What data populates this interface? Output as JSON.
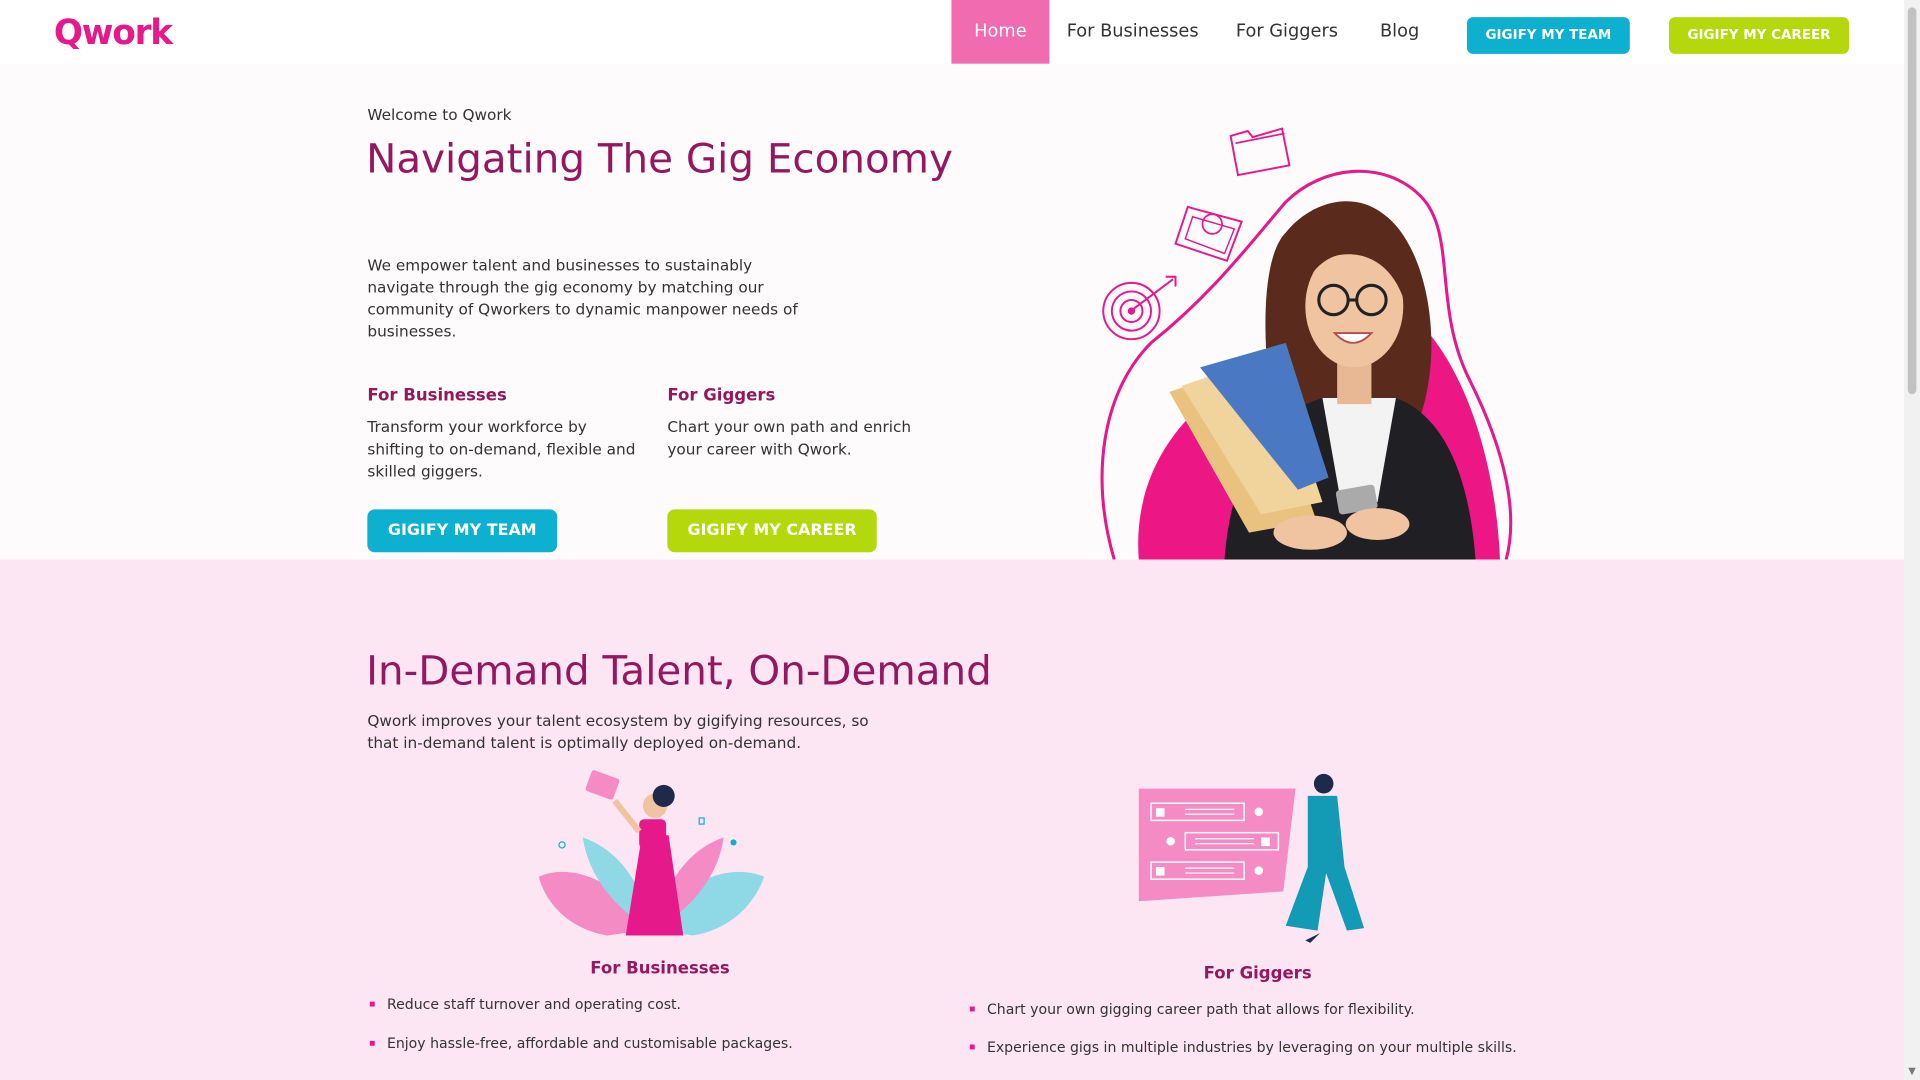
{
  "header": {
    "logo": "Qwork",
    "nav": [
      "Home",
      "For Businesses",
      "For Giggers",
      "Blog"
    ],
    "btn_team": "GIGIFY MY TEAM",
    "btn_career": "GIGIFY MY CAREER"
  },
  "hero": {
    "welcome": "Welcome to Qwork",
    "title": "Navigating The Gig Economy",
    "description": "We empower talent and businesses to sustainably navigate through the gig economy by matching our community of Qworkers to dynamic manpower needs of businesses.",
    "businesses": {
      "heading": "For Businesses",
      "text": "Transform your workforce by shifting to on-demand, flexible and skilled giggers.",
      "button": "GIGIFY MY TEAM"
    },
    "giggers": {
      "heading": "For Giggers",
      "text": "Chart your own path and enrich your career with Qwork.",
      "button": "GIGIFY MY CAREER"
    }
  },
  "talent": {
    "title": "In-Demand Talent, On-Demand",
    "description": "Qwork improves your talent ecosystem by gigifying resources, so that in-demand talent is optimally deployed on-demand.",
    "businesses": {
      "heading": "For Businesses",
      "bullets": [
        "Reduce staff turnover and operating cost.",
        "Enjoy hassle-free, affordable and customisable packages."
      ]
    },
    "giggers": {
      "heading": "For Giggers",
      "bullets": [
        "Chart your own gigging career path that allows for flexibility.",
        "Experience gigs in multiple industries by leveraging on your multiple skills."
      ]
    }
  },
  "colors": {
    "brand_pink": "#e6198a",
    "heading_plum": "#95185f",
    "button_blue": "#0db0cf",
    "button_lime": "#b5d80c",
    "nav_active": "#f06bb0",
    "section_pink": "#fde6f3"
  }
}
